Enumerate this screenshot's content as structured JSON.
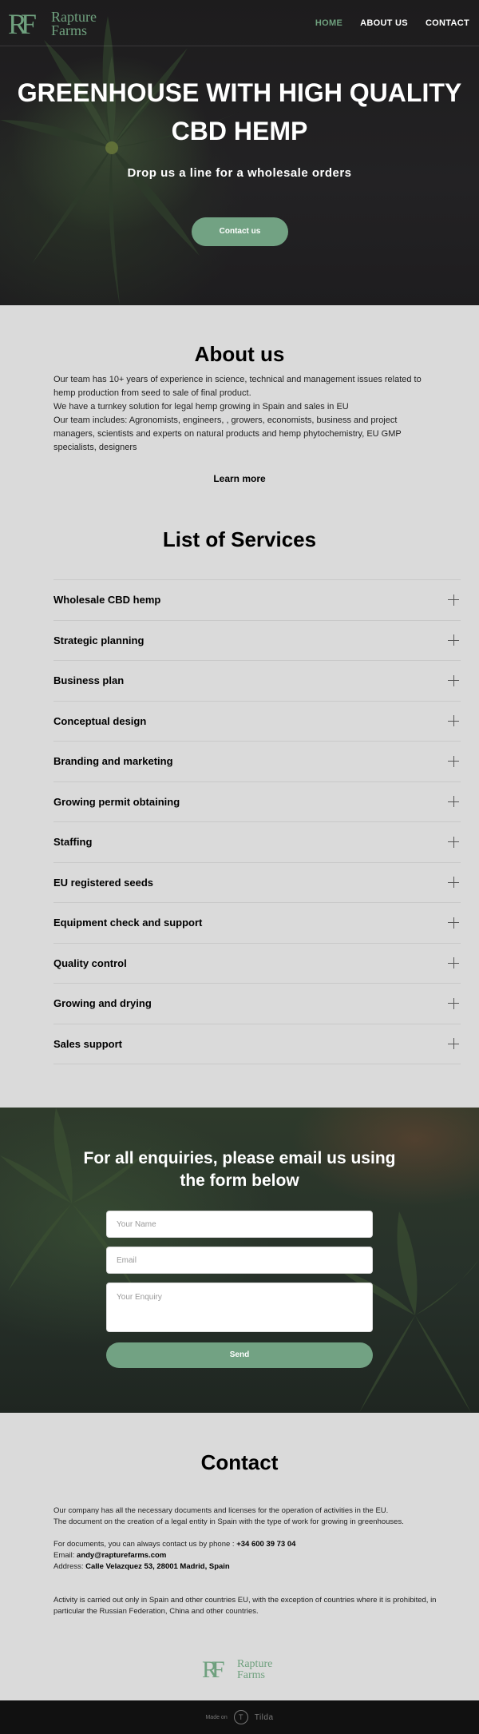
{
  "header": {
    "logo_mark": "RF",
    "logo_line1": "Rapture",
    "logo_line2": "Farms",
    "nav": [
      {
        "label": "HOME",
        "active": true
      },
      {
        "label": "ABOUT US",
        "active": false
      },
      {
        "label": "CONTACT",
        "active": false
      }
    ]
  },
  "hero": {
    "title": "GREENHOUSE WITH HIGH QUALITY CBD HEMP",
    "subtitle": "Drop us a line for a wholesale orders",
    "button": "Contact us"
  },
  "about": {
    "title": "About us",
    "paragraphs": [
      "Our team has 10+ years of experience in science, technical and management issues related to hemp production from seed to sale of final product.",
      "We have a turnkey solution for legal hemp growing in Spain and sales in EU",
      "Our team includes: Agronomists, engineers, , growers, economists, business and project managers, scientists and experts on natural products and hemp phytochemistry, EU GMP specialists, designers"
    ],
    "learn_more": "Learn more"
  },
  "services": {
    "title": "List of Services",
    "items": [
      "Wholesale CBD hemp",
      "Strategic planning",
      "Business plan",
      "Conceptual design",
      "Branding and marketing",
      "Growing permit obtaining",
      "Staffing",
      "EU registered seeds",
      "Equipment check and support",
      "Quality control",
      "Growing and drying",
      "Sales support"
    ]
  },
  "enquiry": {
    "title": "For all enquiries, please email us using the form below",
    "name_placeholder": "Your Name",
    "email_placeholder": "Email",
    "enquiry_placeholder": "Your Enquiry",
    "send": "Send"
  },
  "contact": {
    "title": "Contact",
    "line1": "Our company has all the necessary documents and licenses for the operation of activities in the EU.",
    "line2": "The document on the creation of a legal entity in Spain with the type of work for growing in greenhouses.",
    "phone_label": "For documents, you can always contact us by phone : ",
    "phone": "+34 600 39 73 04",
    "email_label": "Email: ",
    "email": "andy@rapturefarms.com",
    "address_label": "Address: ",
    "address": "Calle Velazquez 53, 28001 Madrid, Spain",
    "note": "Activity is carried out only in Spain and other countries EU, with the exception of countries where it is prohibited, in particular the Russian Federation, China and other countries."
  },
  "footer": {
    "made_on": "Made on",
    "tilda_glyph": "T",
    "tilda": "Tilda"
  },
  "colors": {
    "accent": "#72a283",
    "page_bg": "#dadada"
  }
}
